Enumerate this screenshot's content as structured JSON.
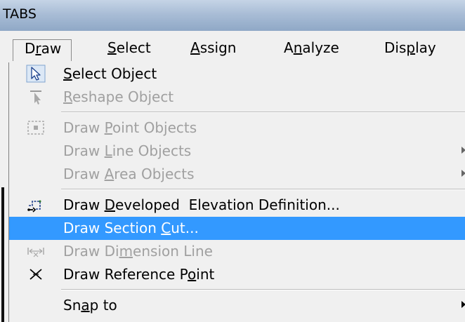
{
  "window": {
    "title": "TABS"
  },
  "menubar": {
    "items": [
      {
        "pre": "D",
        "u": "r",
        "post": "aw",
        "active": true
      },
      {
        "pre": "",
        "u": "S",
        "post": "elect"
      },
      {
        "pre": "",
        "u": "A",
        "post": "ssign"
      },
      {
        "pre": "A",
        "u": "n",
        "post": "alyze"
      },
      {
        "pre": "Dis",
        "u": "p",
        "post": "lay"
      }
    ]
  },
  "menu": {
    "items": [
      {
        "pre": "",
        "u": "S",
        "post": "elect Object",
        "icon": "select-arrow-icon",
        "state": "enabled"
      },
      {
        "pre": "",
        "u": "R",
        "post": "eshape Object",
        "icon": "reshape-icon",
        "state": "disabled"
      },
      {
        "pre": "Draw ",
        "u": "P",
        "post": "oint Objects",
        "icon": "point-object-icon",
        "state": "disabled"
      },
      {
        "pre": "Draw ",
        "u": "L",
        "post": "ine Objects",
        "icon": "",
        "state": "disabled",
        "submenu": true
      },
      {
        "pre": "Draw ",
        "u": "A",
        "post": "rea Objects",
        "icon": "",
        "state": "disabled",
        "submenu": true
      },
      {
        "pre": "Draw ",
        "u": "D",
        "post": "eveloped  Elevation Definition...",
        "icon": "developed-elevation-icon",
        "state": "enabled"
      },
      {
        "pre": "Draw Section ",
        "u": "C",
        "post": "ut...",
        "icon": "",
        "state": "highlighted"
      },
      {
        "pre": "Draw Di",
        "u": "m",
        "post": "ension Line",
        "icon": "dimension-line-icon",
        "state": "disabled"
      },
      {
        "pre": "Draw Reference P",
        "u": "o",
        "post": "int",
        "icon": "reference-point-icon",
        "state": "enabled"
      },
      {
        "pre": "Sn",
        "u": "a",
        "post": "p to",
        "icon": "",
        "state": "enabled",
        "submenu": true
      }
    ]
  }
}
